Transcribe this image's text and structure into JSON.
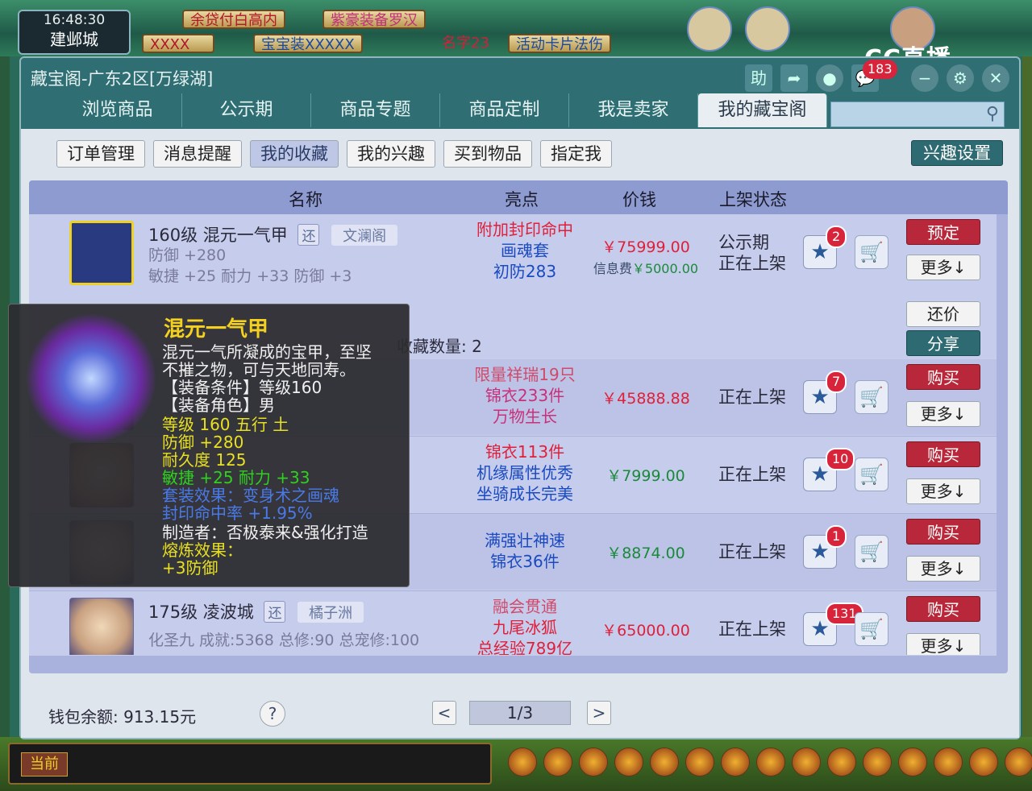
{
  "game_hud": {
    "time": "16:48:30",
    "city": "建邺城",
    "top_tags": [
      "余贷付白高内",
      "紫豪装备罗汉",
      "宝宝装XXXXX",
      "名字23",
      "活动卡片法伤"
    ],
    "hidden_tag": "XXXX",
    "stream_logo": "CC直播"
  },
  "window": {
    "title": "藏宝阁-广东2区[万绿湖]",
    "icons": [
      {
        "name": "help-icon",
        "glyph": "助"
      },
      {
        "name": "share-icon",
        "glyph": "➦"
      },
      {
        "name": "record-icon",
        "glyph": "●"
      },
      {
        "name": "message-icon",
        "glyph": "💬"
      },
      {
        "name": "minimize-icon",
        "glyph": "−"
      },
      {
        "name": "settings-icon",
        "glyph": "⚙"
      },
      {
        "name": "close-icon",
        "glyph": "✕"
      }
    ],
    "message_count": "183"
  },
  "main_tabs": [
    "浏览商品",
    "公示期",
    "商品专题",
    "商品定制",
    "我是卖家",
    "我的藏宝阁"
  ],
  "sub_tabs": [
    "订单管理",
    "消息提醒",
    "我的收藏",
    "我的兴趣",
    "买到物品",
    "指定我"
  ],
  "interest_settings": "兴趣设置",
  "table": {
    "headers": [
      "名称",
      "亮点",
      "价钱",
      "上架状态"
    ],
    "rows": [
      {
        "level_name": "160级 混元一气甲",
        "tag_return": "还",
        "server": "文澜阁",
        "attr1": "防御 +280",
        "attr2": "敏捷 +25 耐力 +33 防御 +3",
        "highlights": [
          "附加封印命中",
          "画魂套",
          "初防283"
        ],
        "price": "￥75999.00",
        "fee_label": "信息费",
        "fee": "￥5000.00",
        "status": [
          "公示期",
          "正在上架"
        ],
        "fav_count": "2",
        "action": "预定",
        "more": "更多↓"
      },
      {
        "highlights": [
          "限量祥瑞19只",
          "锦衣233件",
          "万物生长"
        ],
        "price": "￥45888.88",
        "status": [
          "正在上架"
        ],
        "fav_count": "7",
        "action": "购买",
        "more": "更多↓"
      },
      {
        "highlights": [
          "锦衣113件",
          "机缘属性优秀",
          "坐骑成长完美"
        ],
        "price": "￥7999.00",
        "status": [
          "正在上架"
        ],
        "fav_count": "10",
        "action": "购买",
        "more": "更多↓"
      },
      {
        "highlights": [
          "满强壮神速",
          "锦衣36件"
        ],
        "price": "￥8874.00",
        "status": [
          "正在上架"
        ],
        "fav_count": "1",
        "action": "购买",
        "more": "更多↓"
      },
      {
        "level_name": "175级 凌波城",
        "tag_return": "还",
        "server": "橘子洲",
        "attr1": "化圣九 成就:5368 总修:90 总宠修:100",
        "highlights": [
          "融会贯通",
          "九尾冰狐",
          "总经验789亿"
        ],
        "price": "￥65000.00",
        "status": [
          "正在上架"
        ],
        "fav_count": "131",
        "action": "购买",
        "more": "更多↓"
      }
    ],
    "expanded": {
      "counter_offer": "还价",
      "share": "分享",
      "fav_label": "收藏数量: 2"
    }
  },
  "footer": {
    "wallet": "钱包余额: 913.15元",
    "help": "?",
    "page": "1/3",
    "prev": "<",
    "next": ">"
  },
  "tooltip": {
    "title": "混元一气甲",
    "desc1": "混元一气所凝成的宝甲，至坚",
    "desc2": "不摧之物，可与天地同寿。",
    "req_level": "【装备条件】等级160",
    "req_role": "【装备角色】男",
    "level_element": "等级 160  五行 土",
    "defense": "防御 +280",
    "durability": "耐久度 125",
    "bonus": "敏捷 +25 耐力 +33",
    "set_effect": "套装效果：变身术之画魂",
    "seal_hit": "封印命中率 +1.95%",
    "maker": "制造者：否极泰来&强化打造",
    "smelt": "熔炼效果：",
    "smelt_value": "+3防御"
  },
  "chat": {
    "channel": "当前"
  }
}
